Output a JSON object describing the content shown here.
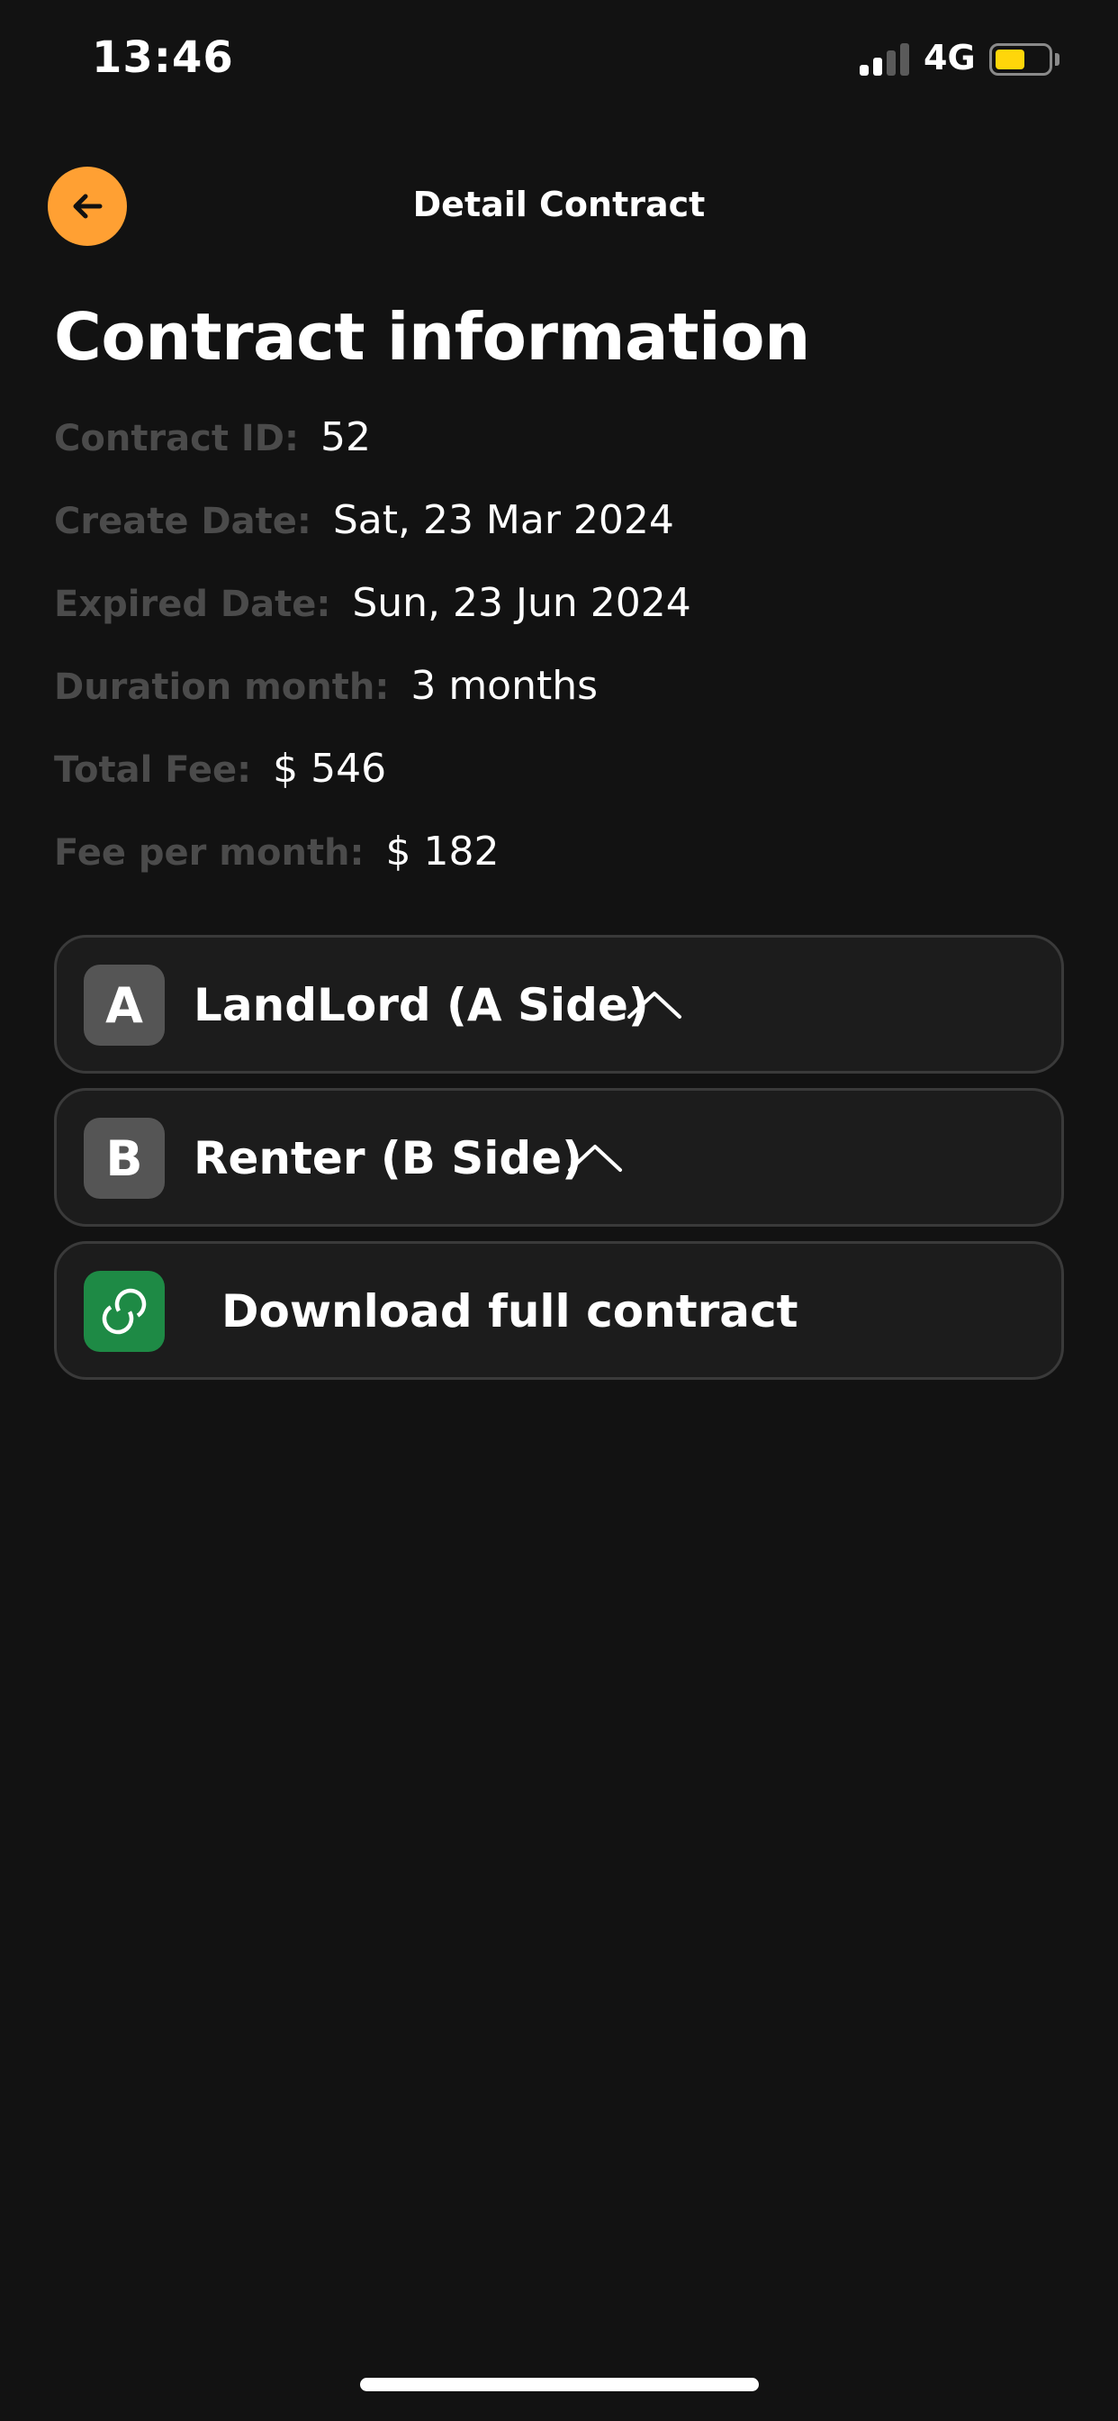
{
  "status_bar": {
    "time": "13:46",
    "network": "4G",
    "battery_color": "#ffd60a"
  },
  "header": {
    "title": "Detail Contract",
    "back_icon": "arrow-left-icon",
    "accent": "#ffa033"
  },
  "contract": {
    "section_title": "Contract information",
    "fields": [
      {
        "label": "Contract ID:",
        "value": "52"
      },
      {
        "label": "Create Date:",
        "value": "Sat, 23 Mar 2024"
      },
      {
        "label": "Expired Date:",
        "value": "Sun, 23 Jun 2024"
      },
      {
        "label": "Duration month:",
        "value": "3 months"
      },
      {
        "label": "Total Fee:",
        "value": "$ 546"
      },
      {
        "label": "Fee per month:",
        "value": "$ 182"
      }
    ]
  },
  "cards": [
    {
      "badge": "A",
      "label": "LandLord (A Side)",
      "icon": "chevron-up-icon"
    },
    {
      "badge": "B",
      "label": "Renter (B Side)",
      "icon": "chevron-up-icon"
    },
    {
      "badge_icon": "link-icon",
      "label": "Download full contract",
      "badge_color": "#1e8a45"
    }
  ]
}
